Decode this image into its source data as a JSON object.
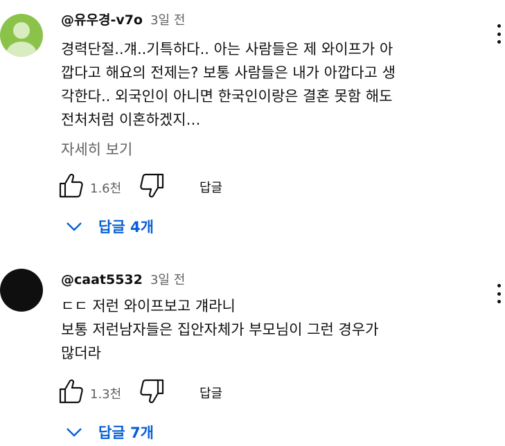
{
  "comments": [
    {
      "author": "@유우경-v7o",
      "time": "3일 전",
      "avatar": "default-user-avatar",
      "lines": [
        "경력단절..걔..기특하다.. 아는 사람들은 제 와이프가 아",
        "깝다고 해요의 전제는? 보통 사람들은 내가 아깝다고 생",
        "각한다.. 외국인이 아니면 한국인이랑은 결혼 못함 해도",
        "전처처럼 이혼하겠지…"
      ],
      "read_more": "자세히 보기",
      "likes": "1.6천",
      "reply_label": "답글",
      "replies_label": "답글 4개"
    },
    {
      "author": "@caat5532",
      "time": "3일 전",
      "avatar": "black-circle-avatar",
      "lines": [
        "ㄷㄷ 저런 와이프보고 걔라니",
        "보통 저런남자들은 집안자체가 부모님이 그런 경우가",
        "많더라"
      ],
      "likes": "1.3천",
      "reply_label": "답글",
      "replies_label": "답글 7개"
    }
  ],
  "colors": {
    "author": "#0f0f0f",
    "meta": "#606060",
    "link": "#065fd4",
    "default_avatar_bg": "#8bc34a",
    "dark_avatar_bg": "#0f0f0f"
  }
}
